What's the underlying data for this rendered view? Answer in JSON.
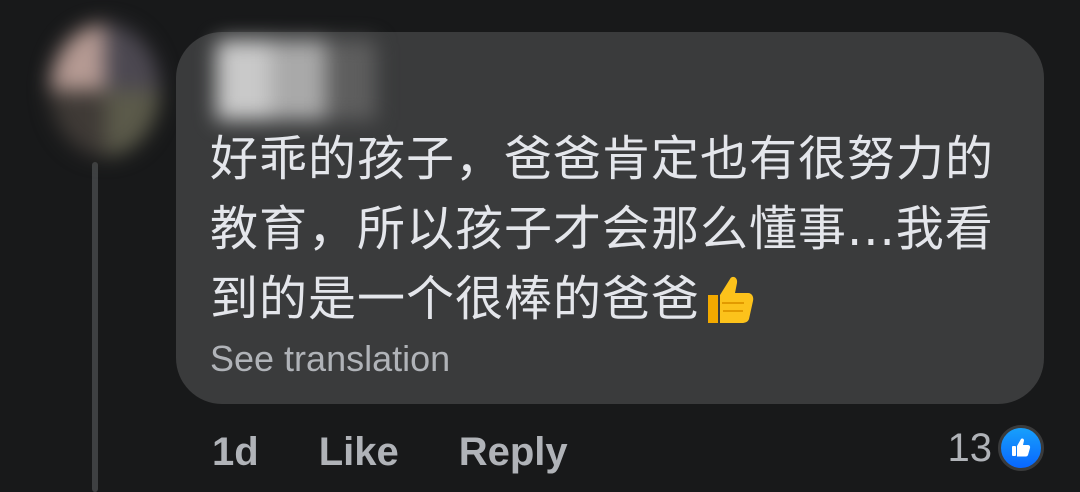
{
  "comment": {
    "author_name": "",
    "text": "好乖的孩子，爸爸肯定也有很努力的教育，所以孩子才会那么懂事...我看到的是一个很棒的爸爸",
    "emoji_icon": "thumbs-up-icon",
    "see_translation_label": "See translation",
    "timestamp": "1d",
    "like_label": "Like",
    "reply_label": "Reply",
    "reaction_count": "13",
    "reaction_icon": "like-reaction-icon"
  },
  "colors": {
    "background": "#18191a",
    "bubble": "#3a3b3c",
    "primary_text": "#e4e6eb",
    "secondary_text": "#b0b3b8",
    "like_blue": "#0866ff"
  }
}
